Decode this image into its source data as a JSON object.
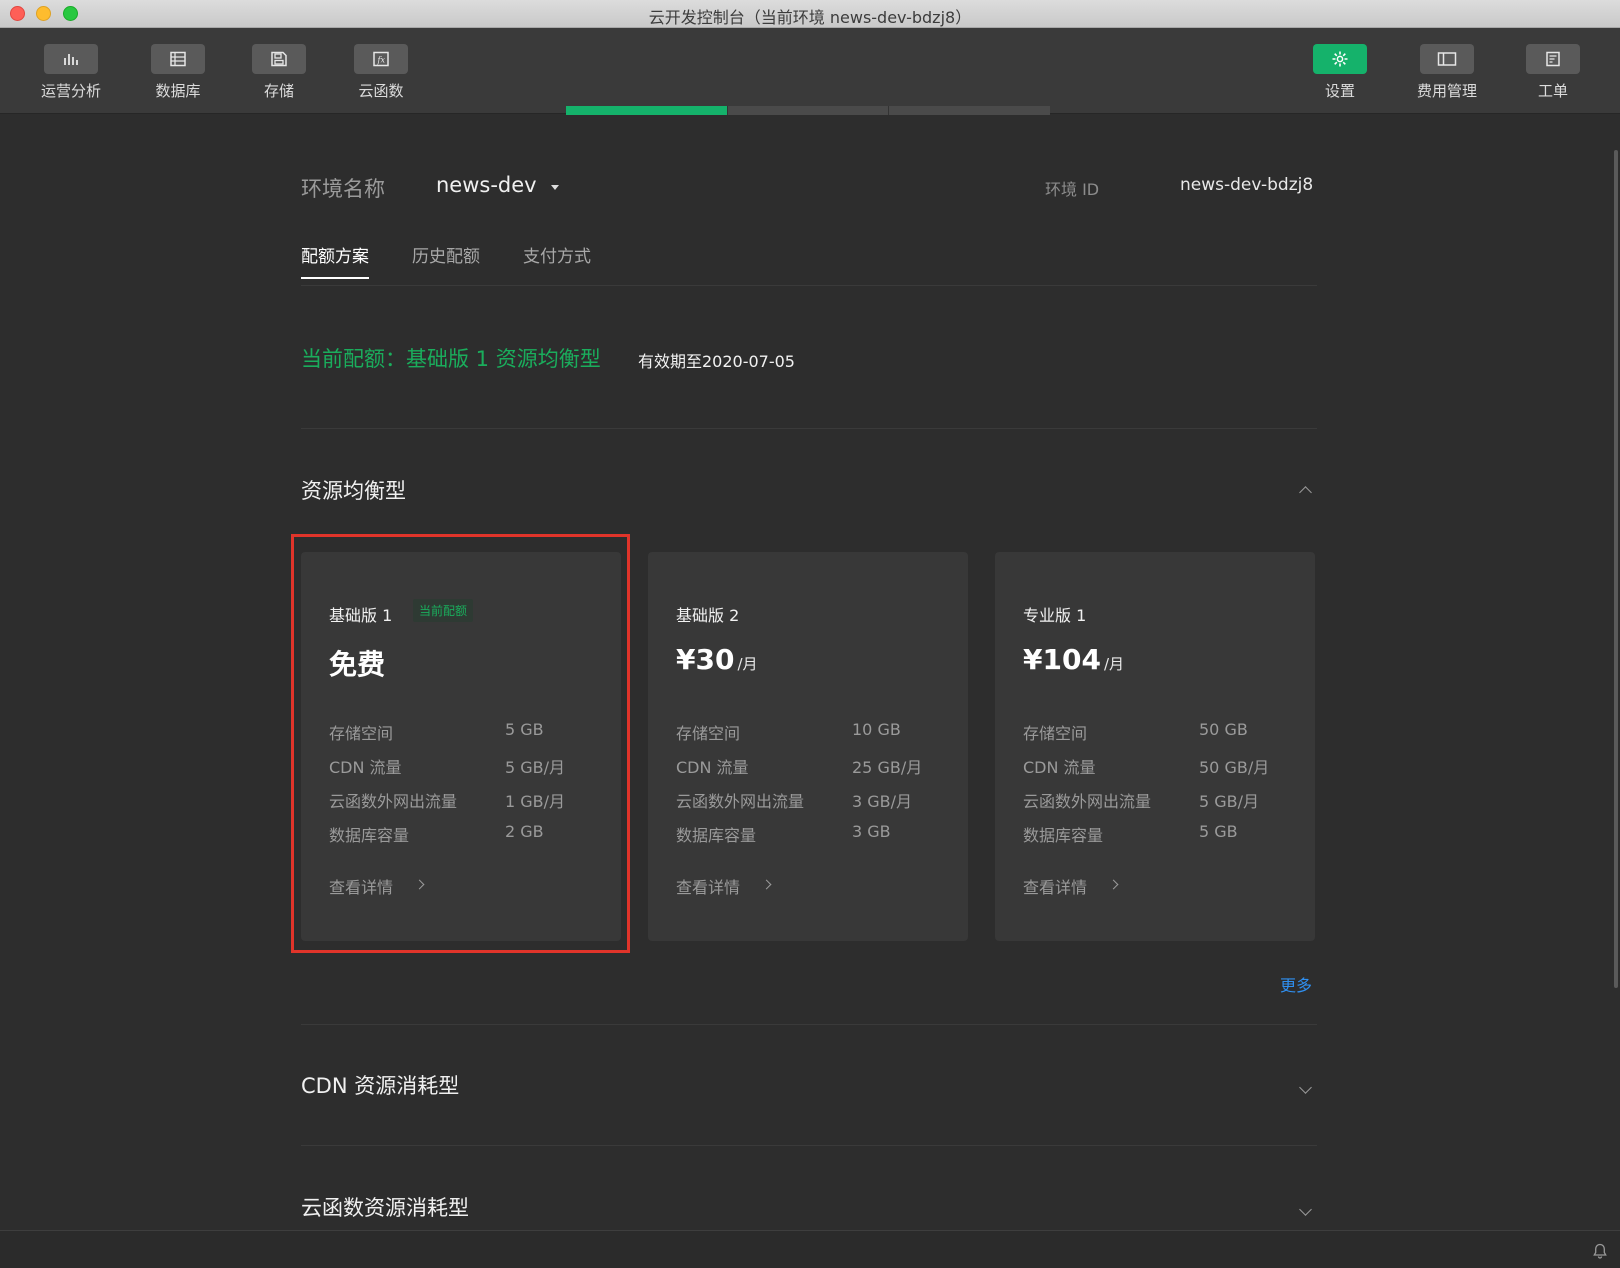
{
  "window": {
    "title": "云开发控制台（当前环境 news-dev-bdzj8）"
  },
  "toolbar": {
    "left": [
      {
        "label": "运营分析",
        "icon": "bar-chart-icon"
      },
      {
        "label": "数据库",
        "icon": "database-icon"
      },
      {
        "label": "存储",
        "icon": "storage-icon"
      },
      {
        "label": "云函数",
        "icon": "function-icon"
      }
    ],
    "right": [
      {
        "label": "设置",
        "icon": "gear-icon",
        "active": true
      },
      {
        "label": "费用管理",
        "icon": "billing-icon"
      },
      {
        "label": "工单",
        "icon": "ticket-icon"
      }
    ]
  },
  "env": {
    "label": "环境名称",
    "name": "news-dev",
    "id_label": "环境 ID",
    "id_value": "news-dev-bdzj8"
  },
  "tabs": [
    {
      "label": "配额方案",
      "active": true
    },
    {
      "label": "历史配额",
      "active": false
    },
    {
      "label": "支付方式",
      "active": false
    }
  ],
  "current_quota": {
    "text": "当前配额：基础版 1 资源均衡型",
    "valid_until": "有效期至2020-07-05"
  },
  "sections": {
    "balanced": {
      "title": "资源均衡型",
      "expanded": true
    },
    "cdn": {
      "title": "CDN 资源消耗型",
      "expanded": false
    },
    "cloud_function": {
      "title": "云函数资源消耗型",
      "expanded": false
    }
  },
  "spec_labels": [
    "存储空间",
    "CDN 流量",
    "云函数外网出流量",
    "数据库容量"
  ],
  "plans": [
    {
      "name": "基础版 1",
      "badge": "当前配额",
      "price": "免费",
      "unit": "",
      "specs": [
        "5 GB",
        "5 GB/月",
        "1 GB/月",
        "2 GB"
      ],
      "detail": "查看详情",
      "current": true
    },
    {
      "name": "基础版 2",
      "badge": "",
      "price": "¥30",
      "unit": "/月",
      "specs": [
        "10 GB",
        "25 GB/月",
        "3 GB/月",
        "3 GB"
      ],
      "detail": "查看详情",
      "current": false
    },
    {
      "name": "专业版 1",
      "badge": "",
      "price": "¥104",
      "unit": "/月",
      "specs": [
        "50 GB",
        "50 GB/月",
        "5 GB/月",
        "5 GB"
      ],
      "detail": "查看详情",
      "current": false
    }
  ],
  "more_label": "更多",
  "colors": {
    "accent_green": "#15b26b",
    "highlight_red": "#e0342a",
    "link_blue": "#2f8ff0",
    "background": "#2d2d2d"
  }
}
